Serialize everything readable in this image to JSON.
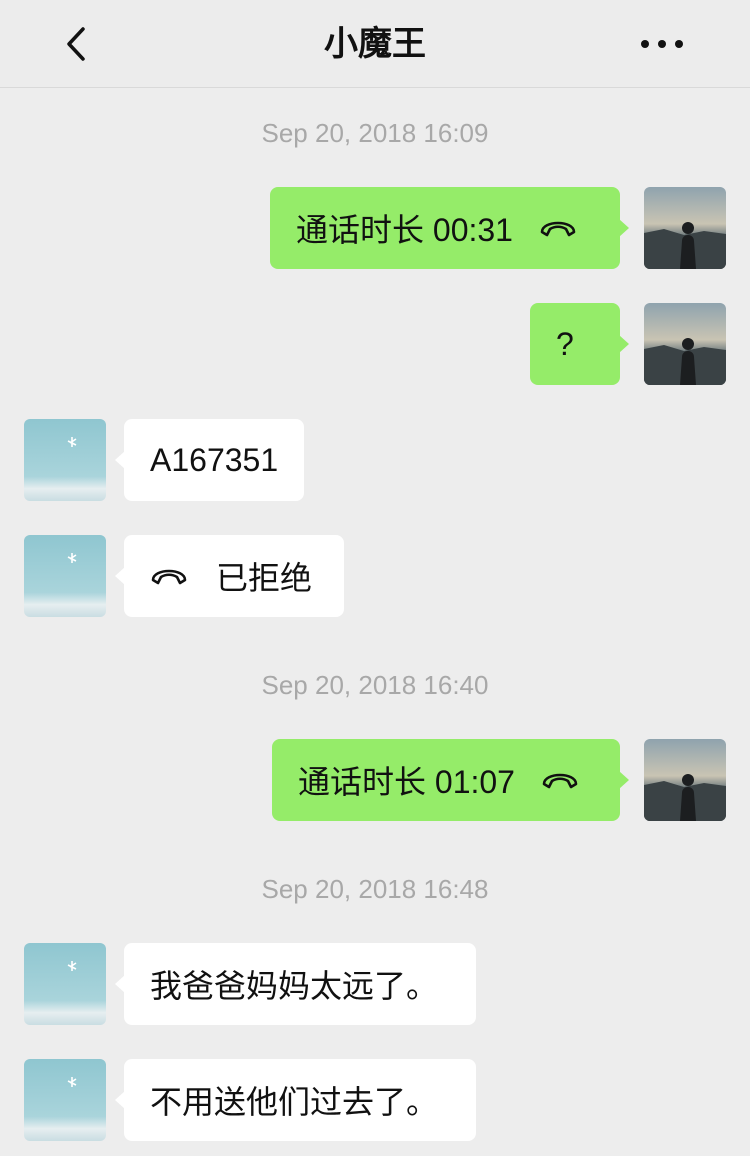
{
  "header": {
    "title": "小魔王",
    "back_icon": "chevron-left-icon",
    "more_icon": "more-horizontal-icon"
  },
  "messages": {
    "ts1": "Sep 20, 2018 16:09",
    "m1_call_label": "通话时长 00:31",
    "m2_text": "?",
    "m3_text": "A167351",
    "m4_call_label": "已拒绝",
    "ts2": "Sep 20, 2018 16:40",
    "m5_call_label": "通话时长 01:07",
    "ts3": "Sep 20, 2018 16:48",
    "m6_text": "我爸爸妈妈太远了。",
    "m7_text": "不用送他们过去了。"
  },
  "colors": {
    "background": "#ededed",
    "outgoing_bubble": "#95ec69",
    "incoming_bubble": "#ffffff",
    "timestamp_text": "#a8a8a8"
  }
}
